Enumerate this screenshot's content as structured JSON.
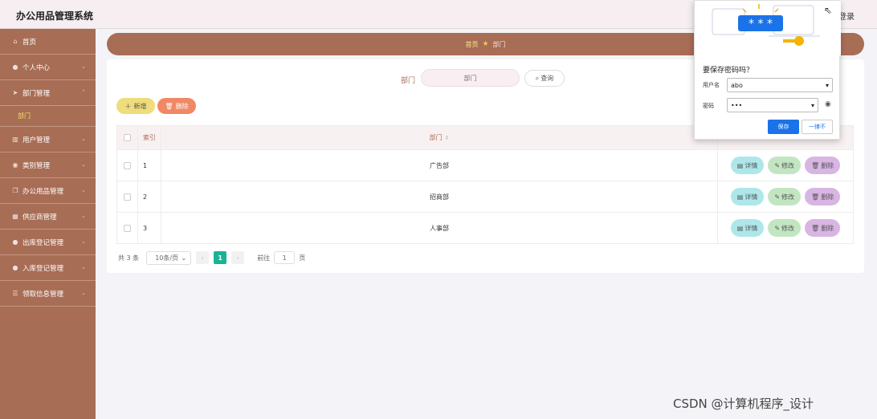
{
  "app": {
    "title": "办公用品管理系统",
    "login": "登录"
  },
  "colors": {
    "sidebar": "#a86d55",
    "accent_yellow": "#efdc7a",
    "accent_orange": "#f08866",
    "pager_active": "#1ab394",
    "detail": "#aee7ea",
    "edit": "#c3e6c2",
    "remove": "#d8b5e3"
  },
  "sidebar": {
    "items": [
      {
        "label": "首页",
        "icon": "home-icon"
      },
      {
        "label": "个人中心",
        "icon": "user-icon"
      },
      {
        "label": "部门管理",
        "icon": "send-icon",
        "sub": "部门"
      },
      {
        "label": "用户管理",
        "icon": "chart-icon"
      },
      {
        "label": "类别管理",
        "icon": "pin-icon"
      },
      {
        "label": "办公用品管理",
        "icon": "copy-icon"
      },
      {
        "label": "供应商管理",
        "icon": "shop-icon"
      },
      {
        "label": "出库登记管理",
        "icon": "user-icon"
      },
      {
        "label": "入库登记管理",
        "icon": "user-icon"
      },
      {
        "label": "领取信息管理",
        "icon": "list-icon"
      }
    ]
  },
  "breadcrumb": {
    "home": "首页",
    "current": "部门"
  },
  "search": {
    "label": "部门",
    "placeholder": "部门",
    "button": "查询"
  },
  "toolbar": {
    "add": "新增",
    "delete": "删除"
  },
  "table": {
    "headers": {
      "index": "索引",
      "dept": "部门"
    },
    "rows": [
      {
        "index": "1",
        "dept": "广告部"
      },
      {
        "index": "2",
        "dept": "招商部"
      },
      {
        "index": "3",
        "dept": "人事部"
      }
    ],
    "actions": {
      "detail": "详情",
      "edit": "修改",
      "remove": "删除"
    }
  },
  "pager": {
    "total": "共 3 条",
    "size": "10条/页",
    "current": "1",
    "goto_prefix": "前往",
    "goto_value": "1",
    "goto_suffix": "页"
  },
  "dialog": {
    "title": "要保存密码吗？",
    "username_label": "用户名",
    "username_value": "abo",
    "password_label": "密码",
    "password_value": "•••",
    "illus_stars": "* * *",
    "save": "保存",
    "never": "一律不"
  },
  "watermark": "CSDN @计算机程序_设计"
}
